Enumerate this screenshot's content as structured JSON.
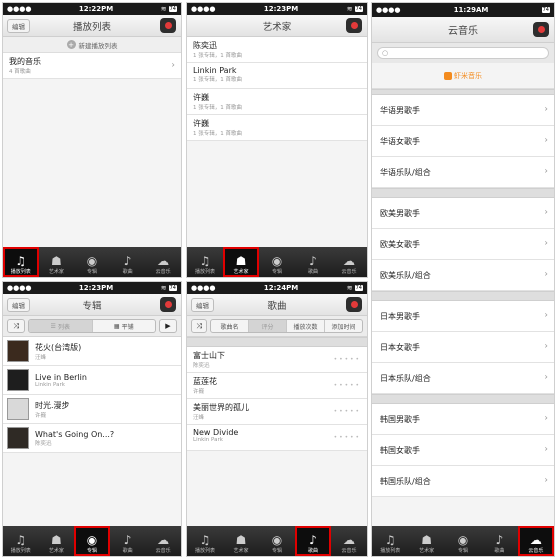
{
  "colors": {
    "accent_red": "#e00000",
    "xiami_orange": "#f38b1e",
    "tabbar_dark": "#1d1d1d"
  },
  "tabs": [
    {
      "label": "播放列表",
      "icon": "playlist-icon"
    },
    {
      "label": "艺术家",
      "icon": "artist-icon"
    },
    {
      "label": "专辑",
      "icon": "album-icon"
    },
    {
      "label": "歌曲",
      "icon": "music-note-icon"
    },
    {
      "label": "云音乐",
      "icon": "cloud-music-icon"
    }
  ],
  "screen_playlists": {
    "time": "12:22PM",
    "title": "播放列表",
    "edit_label": "编辑",
    "new_playlist_label": "新建播放列表",
    "new_playlist_plus": "+",
    "items": [
      {
        "title": "我的音乐",
        "sub": "4 首歌曲"
      }
    ]
  },
  "screen_artists": {
    "time": "12:23PM",
    "title": "艺术家",
    "items": [
      {
        "title": "陈奕迅",
        "sub": "1 张专辑，1 首歌曲"
      },
      {
        "title": "Linkin Park",
        "sub": "1 张专辑，1 首歌曲"
      },
      {
        "title": "许巍",
        "sub": "1 张专辑，1 首歌曲"
      },
      {
        "title": "许巍",
        "sub": "1 张专辑，1 首歌曲"
      }
    ]
  },
  "screen_cloud": {
    "time": "11:29AM",
    "title": "云音乐",
    "xiami_label": "虾米音乐",
    "sections": [
      [
        "华语男歌手",
        "华语女歌手",
        "华语乐队/组合"
      ],
      [
        "欧美男歌手",
        "欧美女歌手",
        "欧美乐队/组合"
      ],
      [
        "日本男歌手",
        "日本女歌手",
        "日本乐队/组合"
      ],
      [
        "韩国男歌手",
        "韩国女歌手",
        "韩国乐队/组合"
      ]
    ]
  },
  "screen_albums": {
    "time": "12:23PM",
    "title": "专辑",
    "edit_label": "编辑",
    "seg": [
      "列表",
      "平铺"
    ],
    "items": [
      {
        "title": "花火(台湾版)",
        "sub": "汪峰"
      },
      {
        "title": "Live in Berlin",
        "sub": "Linkin Park"
      },
      {
        "title": "时光.漫步",
        "sub": "许巍"
      },
      {
        "title": "What's Going On...?",
        "sub": "陈奕迅"
      }
    ]
  },
  "screen_songs": {
    "time": "12:24PM",
    "title": "歌曲",
    "edit_label": "编辑",
    "seg": [
      "歌曲名",
      "评分",
      "播放次数",
      "添加时间"
    ],
    "items": [
      {
        "title": "富士山下",
        "sub": "陈奕迅"
      },
      {
        "title": "蓝莲花",
        "sub": "许巍"
      },
      {
        "title": "美丽世界的孤儿",
        "sub": "汪峰"
      },
      {
        "title": "New Divide",
        "sub": "Linkin Park"
      }
    ],
    "rating_dots": "• • • • •"
  },
  "status": {
    "battery": "74"
  }
}
